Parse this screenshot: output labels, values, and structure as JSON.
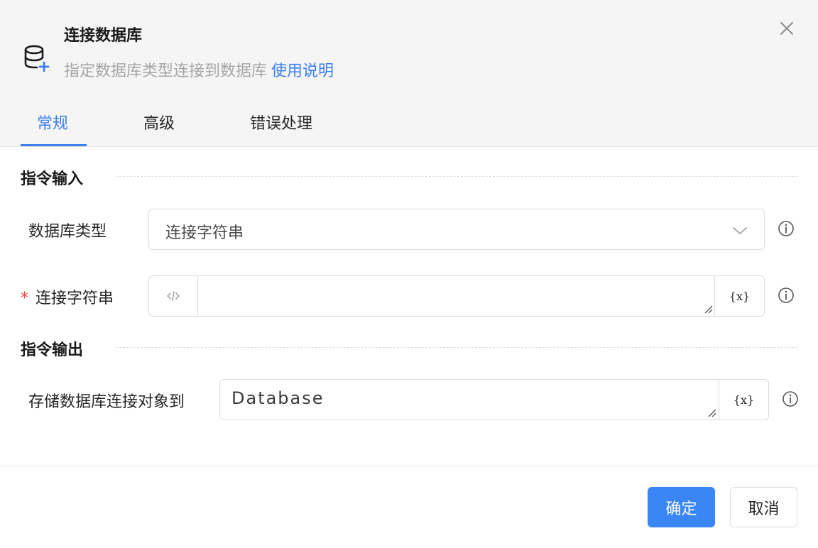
{
  "header": {
    "title": "连接数据库",
    "subtitle": "指定数据库类型连接到数据库",
    "help_link": "使用说明",
    "icon": "database-add-icon",
    "close_icon": "close-icon"
  },
  "tabs": [
    {
      "label": "常规",
      "active": true
    },
    {
      "label": "高级",
      "active": false
    },
    {
      "label": "错误处理",
      "active": false
    }
  ],
  "sections": {
    "input_title": "指令输入",
    "output_title": "指令输出"
  },
  "fields": {
    "db_type": {
      "label": "数据库类型",
      "value": "连接字符串"
    },
    "conn_string": {
      "required_mark": "*",
      "label": "连接字符串",
      "value": "",
      "var_button": "{x}"
    },
    "store_to": {
      "label": "存储数据库连接对象到",
      "value": "Database",
      "var_button": "{x}"
    }
  },
  "footer": {
    "confirm": "确定",
    "cancel": "取消"
  },
  "colors": {
    "accent": "#3b7ff0",
    "primary_button": "#3b86f7",
    "required": "#ee4444"
  }
}
